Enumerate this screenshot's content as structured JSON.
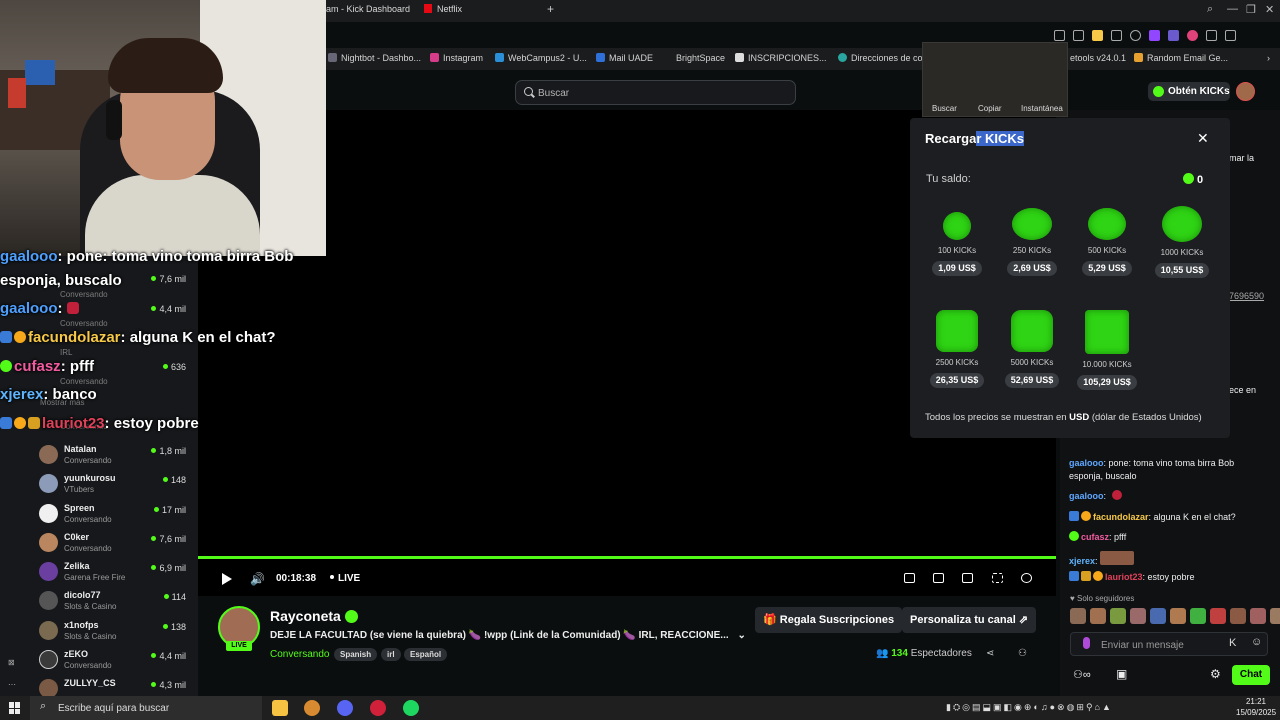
{
  "browser": {
    "tabs": [
      {
        "label": "am - Kick Dashboard"
      },
      {
        "label": "Netflix"
      }
    ],
    "bookmarks": [
      "Nightbot - Dashbo...",
      "Instagram",
      "WebCampus2 - U...",
      "Mail UADE",
      "BrightSpace",
      "INSCRIPCIONES...",
      "Direcciones de co...",
      "etools v24.0.1",
      "Random Email Ge..."
    ]
  },
  "header": {
    "search_placeholder": "Buscar",
    "get_kicks": "Obtén KICKs"
  },
  "snip_tool": {
    "buttons": [
      "Buscar",
      "Copiar",
      "Instantánea"
    ]
  },
  "overlay_chat": {
    "lines": [
      {
        "user": "gaalooo",
        "text": ": pone: toma vino toma birra Bob"
      },
      {
        "user": "",
        "text": "esponja, buscalo"
      },
      {
        "user": "gaalooo",
        "text": ":"
      },
      {
        "user": "facundolazar",
        "text": ": alguna K en el chat?"
      },
      {
        "user": "cufasz",
        "text": ": pfff"
      },
      {
        "user": "xjerex",
        "text": ": banco"
      },
      {
        "user": "lauriot23",
        "text": ": estoy pobre"
      }
    ]
  },
  "sidebar": {
    "faded": [
      "Conversando",
      "Conversando",
      "IRL",
      "Conversando",
      "Mostrar más",
      "Conversando"
    ],
    "faded_view": [
      "7,6 mil",
      "4,4 mil",
      "636"
    ],
    "items": [
      {
        "name": "Natalan",
        "category": "Conversando",
        "viewers": "1,8 mil",
        "color": "#8a6a55"
      },
      {
        "name": "yuunkurosu",
        "category": "VTubers",
        "viewers": "148",
        "color": "#8c9bb8"
      },
      {
        "name": "Spreen",
        "category": "Conversando",
        "viewers": "17 mil",
        "color": "#f0f0f0"
      },
      {
        "name": "C0ker",
        "category": "Conversando",
        "viewers": "7,6 mil",
        "color": "#b9865f"
      },
      {
        "name": "Zelika",
        "category": "Garena Free Fire",
        "viewers": "6,9 mil",
        "color": "#6a3fa0"
      },
      {
        "name": "dicolo77",
        "category": "Slots & Casino",
        "viewers": "114",
        "color": "#555"
      },
      {
        "name": "x1nofps",
        "category": "Slots & Casino",
        "viewers": "138",
        "color": "#7a6a50"
      },
      {
        "name": "zEKO",
        "category": "Conversando",
        "viewers": "4,4 mil",
        "color": "#3a3a3a"
      },
      {
        "name": "ZULLYY_CS",
        "category": "",
        "viewers": "4,3 mil",
        "color": "#7a5a45"
      }
    ]
  },
  "player": {
    "time": "00:18:38",
    "live": "LIVE"
  },
  "stream": {
    "name": "Rayconeta",
    "live_tag": "LIVE",
    "title": "DEJE LA FACULTAD (se viene la quiebra) 🍆 !wpp (Link de la Comunidad) 🍆 IRL, REACCIONE...",
    "category": "Conversando",
    "tags": [
      "Spanish",
      "irl",
      "Español"
    ],
    "gift_button": "Regala Suscripciones",
    "customize_button": "Personaliza tu canal",
    "viewers_count": "134",
    "viewers_label": "Espectadores"
  },
  "kicks_panel": {
    "title_a": "Recarga",
    "title_b": "r KICKs",
    "balance_label": "Tu saldo:",
    "balance": "0",
    "packs": [
      {
        "amount": "100 KICKs",
        "price": "1,09 US$"
      },
      {
        "amount": "250 KICKs",
        "price": "2,69 US$"
      },
      {
        "amount": "500 KICKs",
        "price": "5,29 US$"
      },
      {
        "amount": "1000 KICKs",
        "price": "10,55 US$"
      },
      {
        "amount": "2500 KICKs",
        "price": "26,35 US$"
      },
      {
        "amount": "5000 KICKs",
        "price": "52,69 US$"
      },
      {
        "amount": "10.000 KICKs",
        "price": "105,29 US$"
      }
    ],
    "note_a": "Todos los precios se muestran en ",
    "note_b": "USD",
    "note_c": " (dólar de Estados Unidos)"
  },
  "right_fragments": [
    "mar la",
    "7696590",
    "ece en"
  ],
  "chat": {
    "messages": [
      {
        "user": "gaalooo",
        "text": ": pone: toma vino toma birra Bob"
      },
      {
        "user": "",
        "text": "esponja, buscalo"
      },
      {
        "user": "gaalooo",
        "text": ":"
      },
      {
        "user": "facundolazar",
        "text": ": alguna K en el chat?"
      },
      {
        "user": "cufasz",
        "text": ": pfff"
      },
      {
        "user": "xjerex",
        "text": ":"
      },
      {
        "user": "lauriot23",
        "text": ": estoy pobre"
      }
    ],
    "followers_only": "Solo seguidores",
    "input_placeholder": "Enviar un mensaje",
    "send_button": "Chat"
  },
  "taskbar": {
    "search_placeholder": "Escribe aquí para buscar",
    "time": "21:21",
    "date": "15/09/2025"
  }
}
